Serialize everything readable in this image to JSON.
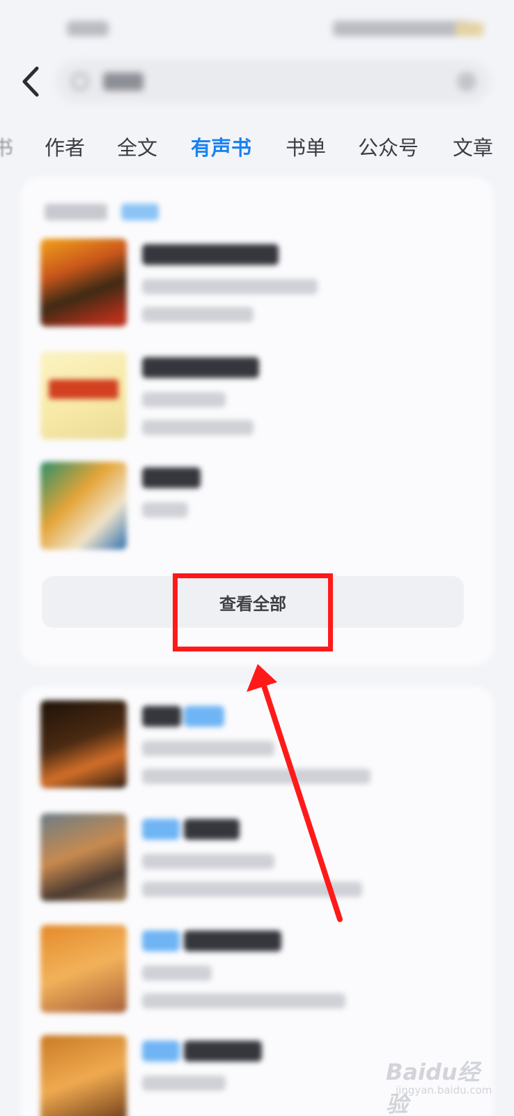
{
  "header": {
    "back_icon": "chevron-left-icon"
  },
  "tabs": [
    {
      "label": "书",
      "active": false
    },
    {
      "label": "作者",
      "active": false
    },
    {
      "label": "全文",
      "active": false
    },
    {
      "label": "有声书",
      "active": true
    },
    {
      "label": "书单",
      "active": false
    },
    {
      "label": "公众号",
      "active": false
    },
    {
      "label": "文章",
      "active": false
    }
  ],
  "colors": {
    "accent": "#1a82f0",
    "highlight": "#ff1a1a",
    "background": "#f3f4f8"
  },
  "audiobook_section": {
    "view_all_label": "查看全部"
  },
  "watermark": {
    "brand": "Baidu经验",
    "url": "jingyan.baidu.com"
  }
}
